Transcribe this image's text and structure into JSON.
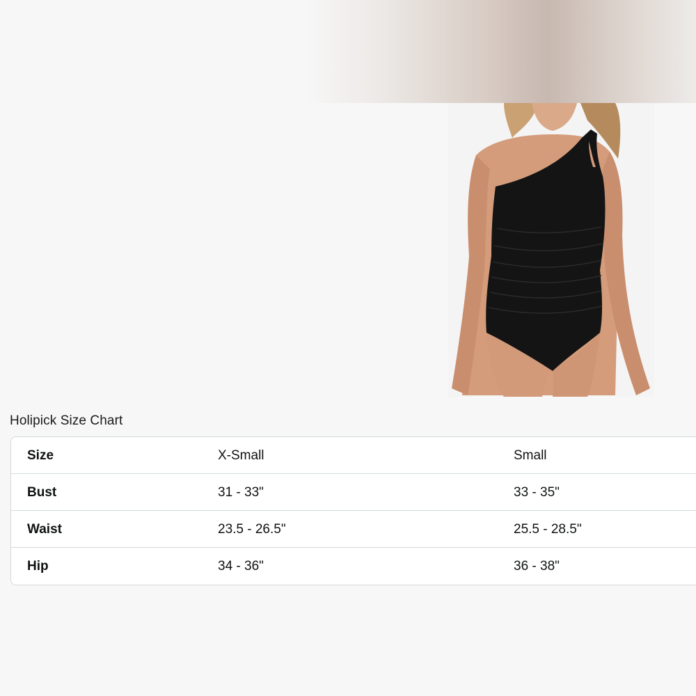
{
  "size_chart": {
    "title": "Holipick Size Chart",
    "columns": [
      "X-Small",
      "Small"
    ],
    "rows": [
      {
        "label": "Size",
        "values": [
          "X-Small",
          "Small"
        ]
      },
      {
        "label": "Bust",
        "values": [
          "31 - 33\"",
          "33 - 35\""
        ]
      },
      {
        "label": "Waist",
        "values": [
          "23.5 - 26.5\"",
          "25.5 - 28.5\""
        ]
      },
      {
        "label": "Hip",
        "values": [
          "34 - 36\"",
          "36 - 38\""
        ]
      }
    ]
  },
  "colors": {
    "background": "#f7f7f7",
    "table_border": "#d5d9d9",
    "text": "#0f1111"
  }
}
